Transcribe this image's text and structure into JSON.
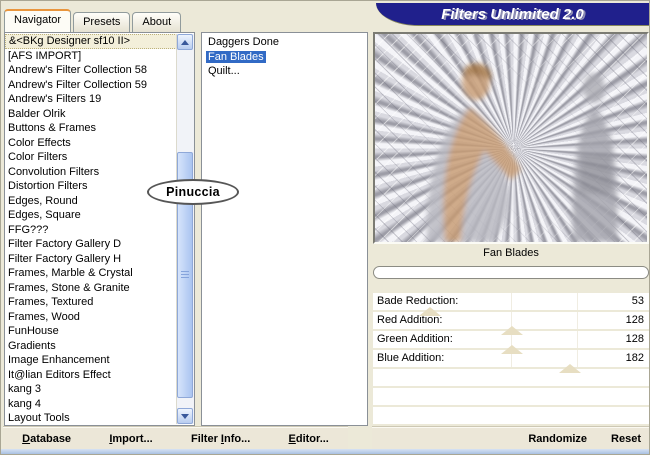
{
  "window": {
    "title": "Filters Unlimited 2.0"
  },
  "tabs": [
    {
      "label": "Navigator",
      "active": true
    },
    {
      "label": "Presets",
      "active": false
    },
    {
      "label": "About",
      "active": false
    }
  ],
  "category_list": {
    "selected_index": 0,
    "items": [
      "&<BKg Designer sf10 II>",
      "[AFS IMPORT]",
      "Andrew's Filter Collection 58",
      "Andrew's Filter Collection 59",
      "Andrew's Filters 19",
      "Balder Olrik",
      "Buttons & Frames",
      "Color Effects",
      "Color Filters",
      "Convolution Filters",
      "Distortion Filters",
      "Edges, Round",
      "Edges, Square",
      "FFG???",
      "Filter Factory Gallery D",
      "Filter Factory Gallery H",
      "Frames, Marble & Crystal",
      "Frames, Stone & Granite",
      "Frames, Textured",
      "Frames, Wood",
      "FunHouse",
      "Gradients",
      "Image Enhancement",
      "It@lian Editors Effect",
      "kang 3",
      "kang 4",
      "Layout Tools"
    ]
  },
  "filter_list": {
    "selected_index": 1,
    "items": [
      "Daggers Done",
      "Fan Blades",
      "Quilt..."
    ]
  },
  "watermark": {
    "text": "Pinuccia"
  },
  "preview": {
    "caption": "Fan Blades"
  },
  "sliders": {
    "max": 255,
    "ticks_pct": [
      50,
      74
    ],
    "empty_rows": 3,
    "rows": [
      {
        "label": "Bade Reduction:",
        "value": 53
      },
      {
        "label": "Red Addition:",
        "value": 128
      },
      {
        "label": "Green Addition:",
        "value": 128
      },
      {
        "label": "Blue Addition:",
        "value": 182
      }
    ]
  },
  "action_buttons": [
    {
      "name": "database",
      "pre": "",
      "key": "D",
      "post": "atabase"
    },
    {
      "name": "import",
      "pre": "",
      "key": "I",
      "post": "mport..."
    },
    {
      "name": "filter-info",
      "pre": "Filter ",
      "key": "I",
      "post": "nfo..."
    },
    {
      "name": "editor",
      "pre": "",
      "key": "E",
      "post": "ditor..."
    }
  ],
  "result_buttons": [
    {
      "name": "randomize",
      "label": "Randomize"
    },
    {
      "name": "reset",
      "label": "Reset"
    }
  ],
  "colors": {
    "window_bg": "#ece9d8",
    "banner_navy": "#20208c",
    "selection_blue": "#316ac5",
    "soft_selection_cream": "#f3efda",
    "slider_marker_beige": "#e7dec2",
    "bottom_strip_blue": "#a9c1e2"
  }
}
